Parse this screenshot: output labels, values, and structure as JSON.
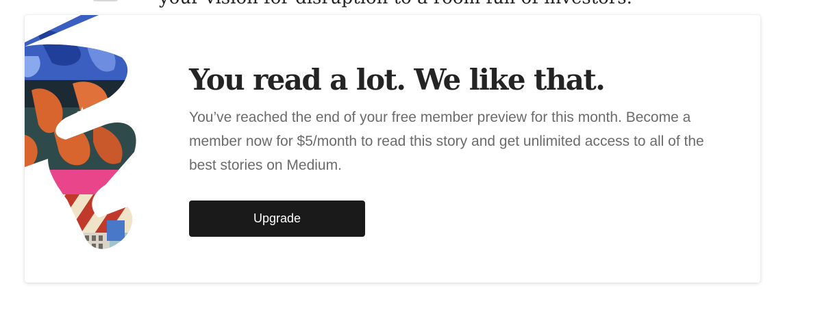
{
  "article": {
    "peek_text": "your vision for disruption to a room full of investors."
  },
  "paywall": {
    "title": "You read a lot. We like that.",
    "body": "You’ve reached the end of your free member preview for this month. Become a member now for $5/month to read this story and get unlimited access to all of the best stories on Medium.",
    "upgrade_label": "Upgrade",
    "illustration_icon": "abstract-collage-illustration",
    "colors": {
      "button_bg": "#1a1a1a",
      "button_text": "#ffffff",
      "title": "#242424",
      "body": "#6b6b6b",
      "art_blue": "#3a5fc0",
      "art_orange": "#d8652d",
      "art_teal": "#2f4a4a",
      "art_pink": "#e8458a",
      "art_red": "#c0392b",
      "art_cream": "#efe3c8",
      "art_sky": "#9fc3cf"
    }
  }
}
